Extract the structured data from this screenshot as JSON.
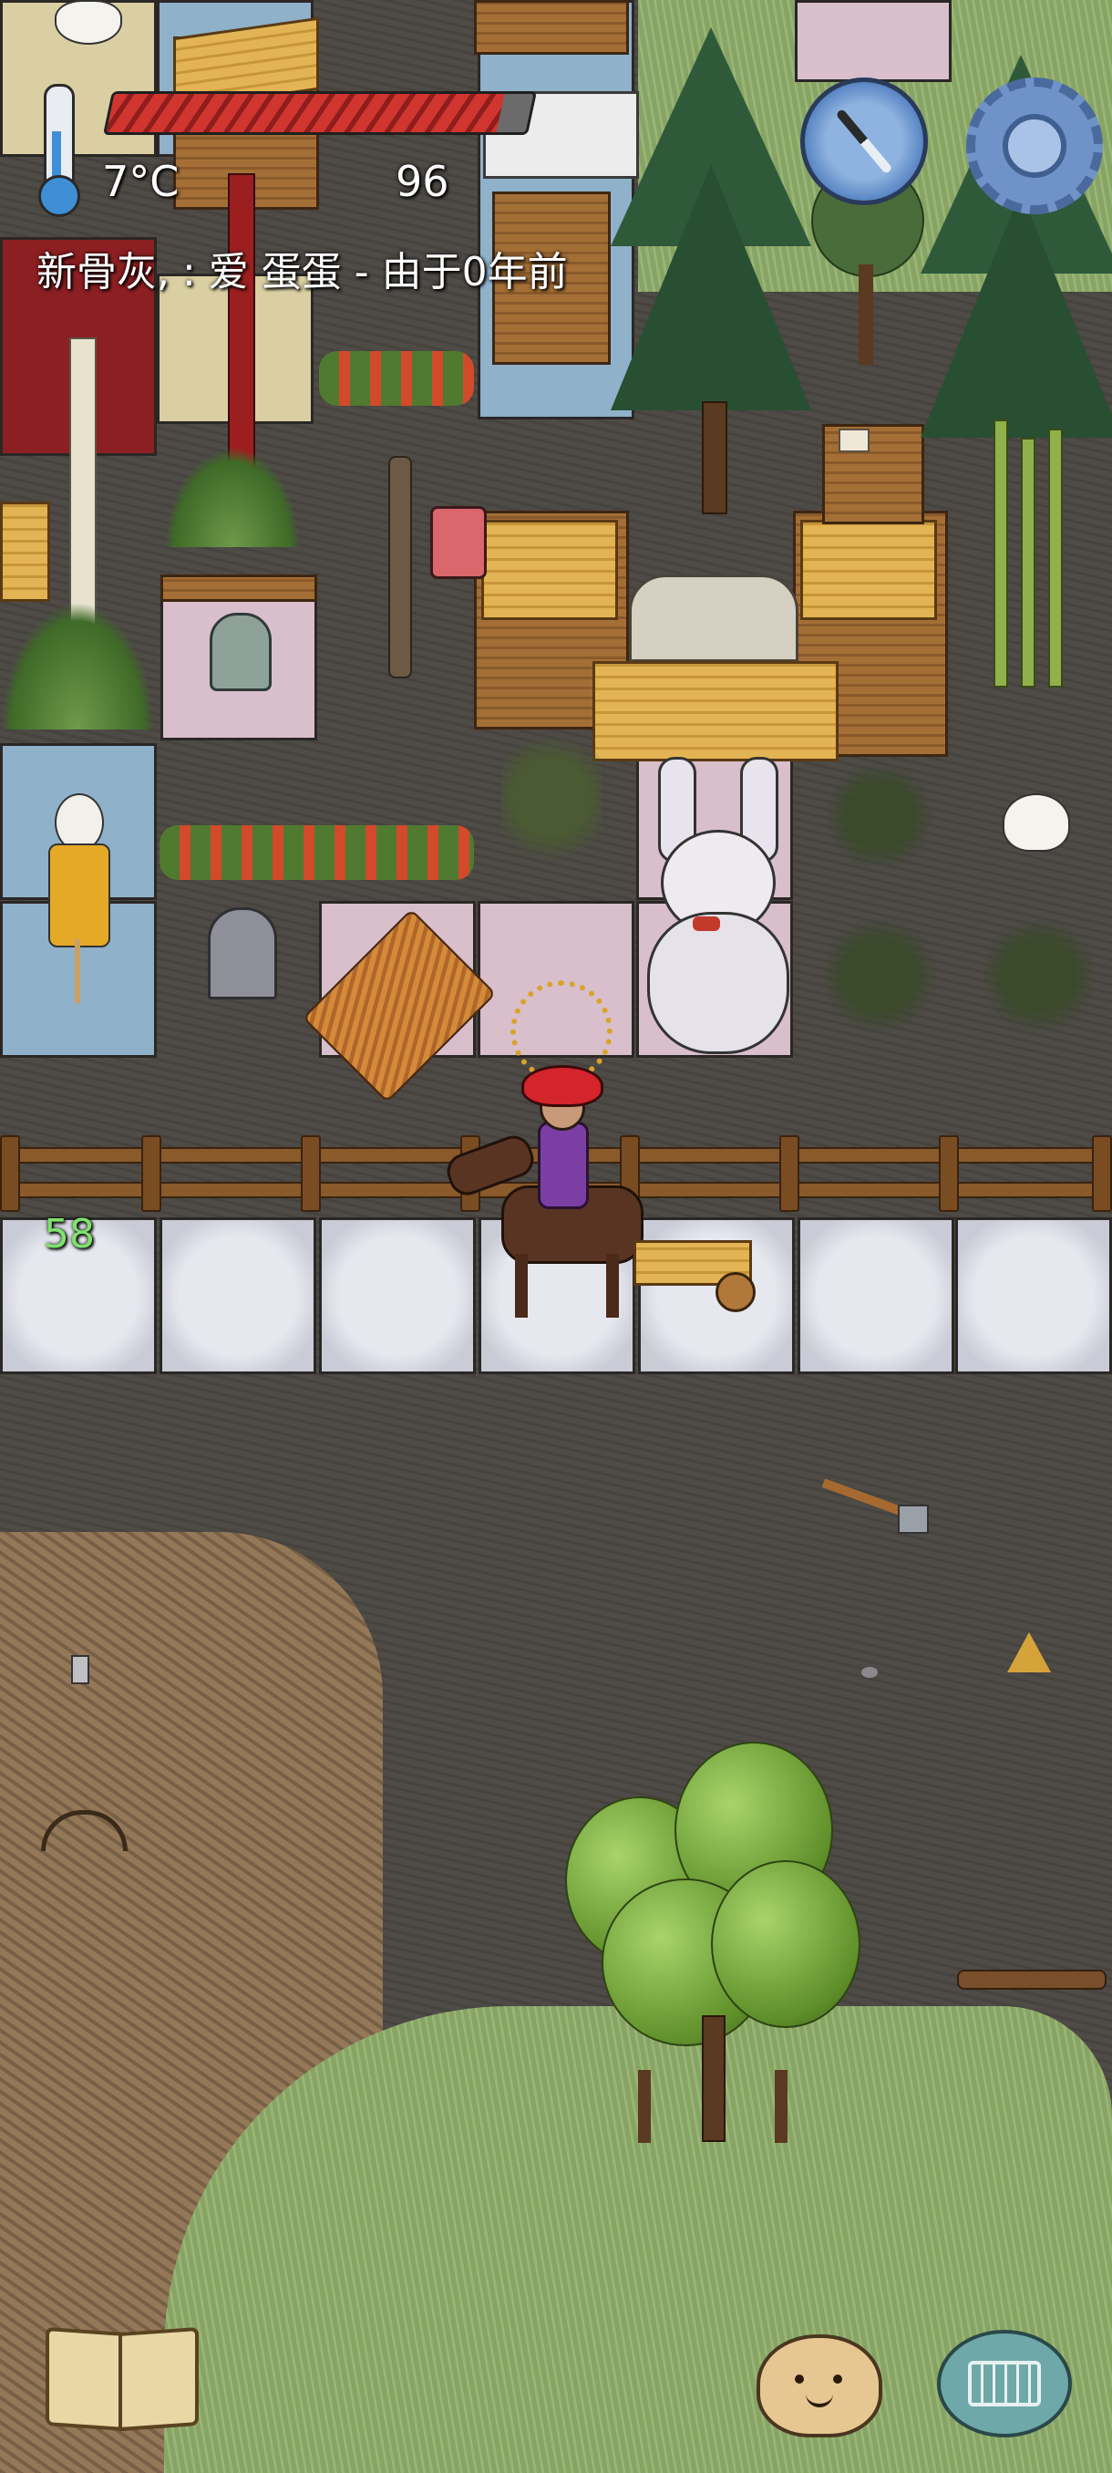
{
  "hud": {
    "temperature": "7°C",
    "food_value": "96",
    "health_level": 0.93,
    "status_message": "新骨灰, : 爱 蛋蛋 - 由于0年前",
    "age_counter": "58"
  },
  "icons": {
    "thermometer": "thermometer-icon",
    "compass": "compass-icon",
    "settings": "gear-icon",
    "recipe_book": "book-icon",
    "emote": "emote-face-icon",
    "keyboard": "keyboard-icon"
  },
  "colors": {
    "health": "#d0352f",
    "counter_green": "#7de36a",
    "compass_blue": "#5a86c4",
    "gear_blue": "#6f93c8",
    "chat_teal": "#6fa8a8"
  }
}
